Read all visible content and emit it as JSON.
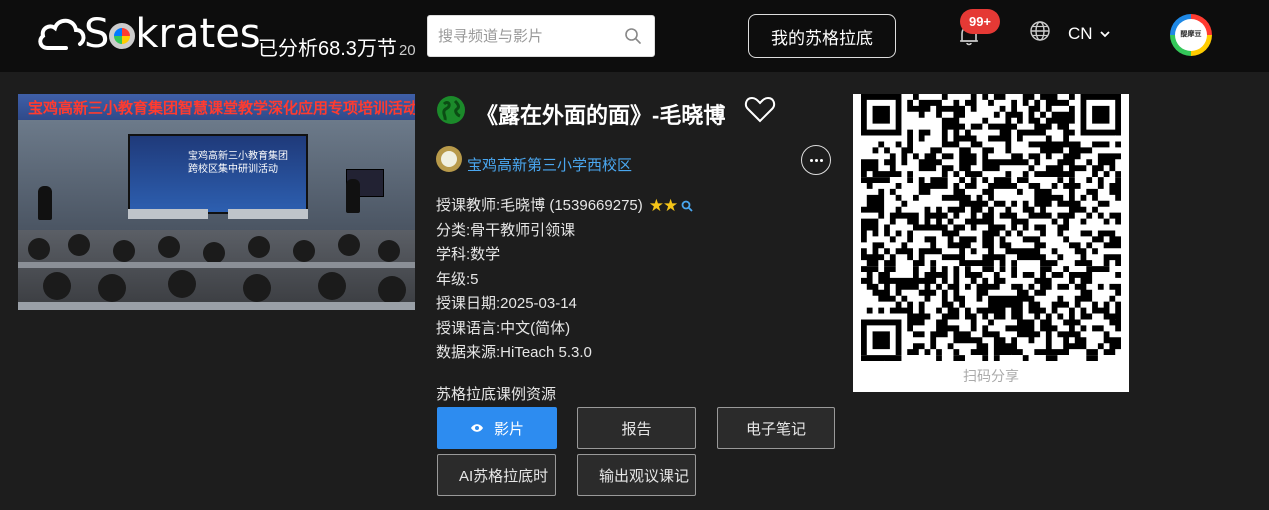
{
  "header": {
    "logo_text": "Sokrates",
    "stats": "已分析68.3万节",
    "stats_suffix": "20",
    "search_placeholder": "搜寻频道与影片",
    "my_button": "我的苏格拉底",
    "notification_badge": "99+",
    "language": "CN",
    "avatar_text": "醍摩豆"
  },
  "video": {
    "thumbnail_banner": "宝鸡高新三小教育集团智慧课堂教学深化应用专项培训活动",
    "thumbnail_screen_text": [
      "宝鸡高新三小教育集团",
      "跨校区集中研训活动"
    ],
    "title": "《露在外面的面》-毛晓博",
    "school": "宝鸡高新第三小学西校区"
  },
  "info": [
    {
      "label": "授课教师: ",
      "value": "毛晓博 (1539669275)"
    },
    {
      "label": "分类: ",
      "value": "骨干教师引领课"
    },
    {
      "label": "学科: ",
      "value": "数学"
    },
    {
      "label": "年级: ",
      "value": "5"
    },
    {
      "label": "授课日期: ",
      "value": "2025-03-14"
    },
    {
      "label": "授课语言: ",
      "value": "中文(简体)"
    },
    {
      "label": "数据来源: ",
      "value": "HiTeach 5.3.0"
    }
  ],
  "teacher_stars": "★★",
  "resources": {
    "title": "苏格拉底课例资源",
    "buttons": [
      "影片",
      "报告",
      "电子笔记",
      "AI苏格拉底时",
      "输出观议课记"
    ]
  },
  "qr": {
    "caption": "扫码分享"
  },
  "colors": {
    "accent": "#2d8cf0",
    "header_bg": "#0d0d0d",
    "page_bg": "#1d1d1d",
    "link": "#4aa7f0",
    "badge": "#e53935",
    "star": "#f5c518"
  }
}
